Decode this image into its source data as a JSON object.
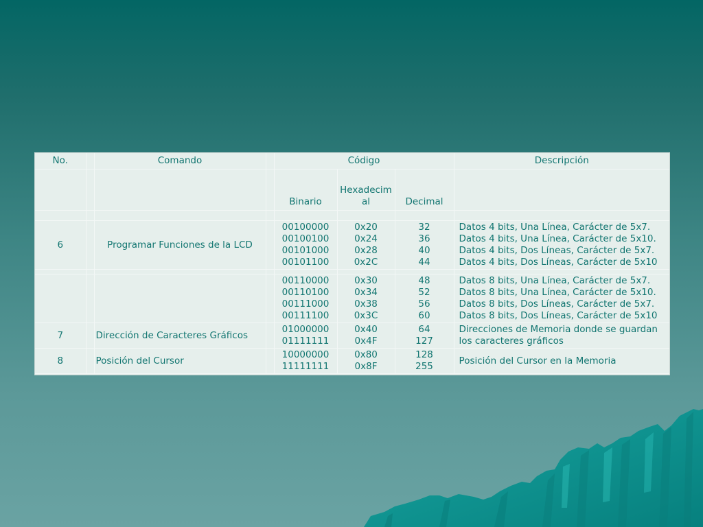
{
  "table": {
    "headers": {
      "no": "No.",
      "comando": "Comando",
      "codigo": "Código",
      "descripcion": "Descripción"
    },
    "subheaders": {
      "binario": "Binario",
      "hex_line1": "Hexadecim",
      "hex_line2": "al",
      "decimal": "Decimal"
    },
    "rows": [
      {
        "no": "6",
        "comando": "Programar Funciones de la LCD",
        "binario": [
          "00100000",
          "00100100",
          "00101000",
          "00101100"
        ],
        "hex": [
          "0x20",
          "0x24",
          "0x28",
          "0x2C"
        ],
        "decimal": [
          "32",
          "36",
          "40",
          "44"
        ],
        "descripcion": [
          "Datos 4 bits, Una Línea, Carácter de 5x7.",
          "Datos 4 bits, Una Línea, Carácter de 5x10.",
          "Datos 4 bits, Dos Líneas, Carácter de 5x7.",
          "Datos 4 bits, Dos Líneas, Carácter de 5x10"
        ]
      },
      {
        "no": "",
        "comando": "",
        "binario": [
          "00110000",
          "00110100",
          "00111000",
          "00111100"
        ],
        "hex": [
          "0x30",
          "0x34",
          "0x38",
          "0x3C"
        ],
        "decimal": [
          "48",
          "52",
          "56",
          "60"
        ],
        "descripcion": [
          "Datos 8 bits, Una Línea, Carácter de 5x7.",
          "Datos 8 bits, Una Línea, Carácter de 5x10.",
          "Datos 8 bits, Dos Líneas, Carácter de 5x7.",
          "Datos 8 bits, Dos Líneas, Carácter de 5x10"
        ]
      },
      {
        "no": "7",
        "comando": "Dirección de Caracteres Gráficos",
        "binario": [
          "01000000",
          "01111111"
        ],
        "hex": [
          "0x40",
          "0x4F"
        ],
        "decimal": [
          "64",
          "127"
        ],
        "descripcion": [
          "Direcciones de Memoria donde se guardan",
          "los caracteres gráficos"
        ]
      },
      {
        "no": "8",
        "comando": "Posición del Cursor",
        "binario": [
          "10000000",
          "11111111"
        ],
        "hex": [
          "0x80",
          "0x8F"
        ],
        "decimal": [
          "128",
          "255"
        ],
        "descripcion": [
          "Posición del Cursor en la Memoria"
        ]
      }
    ]
  },
  "colors": {
    "text": "#117570",
    "table_bg": "#e6efec",
    "background_top": "#036664",
    "background_bottom": "#6aa3a3",
    "mountain": "#0f9a97"
  }
}
